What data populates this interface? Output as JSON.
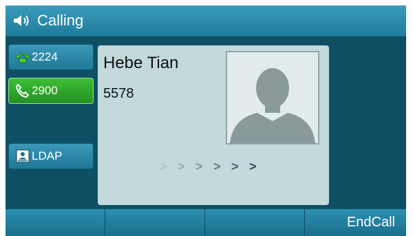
{
  "header": {
    "title": "Calling",
    "icon": "speaker-icon"
  },
  "lines": [
    {
      "label": "2224",
      "icon": "phone-handset-icon",
      "state": "idle"
    },
    {
      "label": "2900",
      "icon": "phone-calling-icon",
      "state": "active"
    },
    {
      "label": "LDAP",
      "icon": "directory-icon",
      "state": "idle"
    }
  ],
  "call": {
    "name": "Hebe Tian",
    "number": "5578",
    "progress_arrows": [
      ">",
      ">",
      ">",
      ">",
      ">",
      ">"
    ]
  },
  "softkeys": [
    "",
    "",
    "",
    "EndCall"
  ],
  "colors": {
    "background": "#0f4f64",
    "header": "#2b8db0",
    "active_line": "#2ea82a",
    "card": "#c3d9dc",
    "arrow_dim": "#a9c6cc",
    "arrow_bright": "#2c4b57"
  }
}
